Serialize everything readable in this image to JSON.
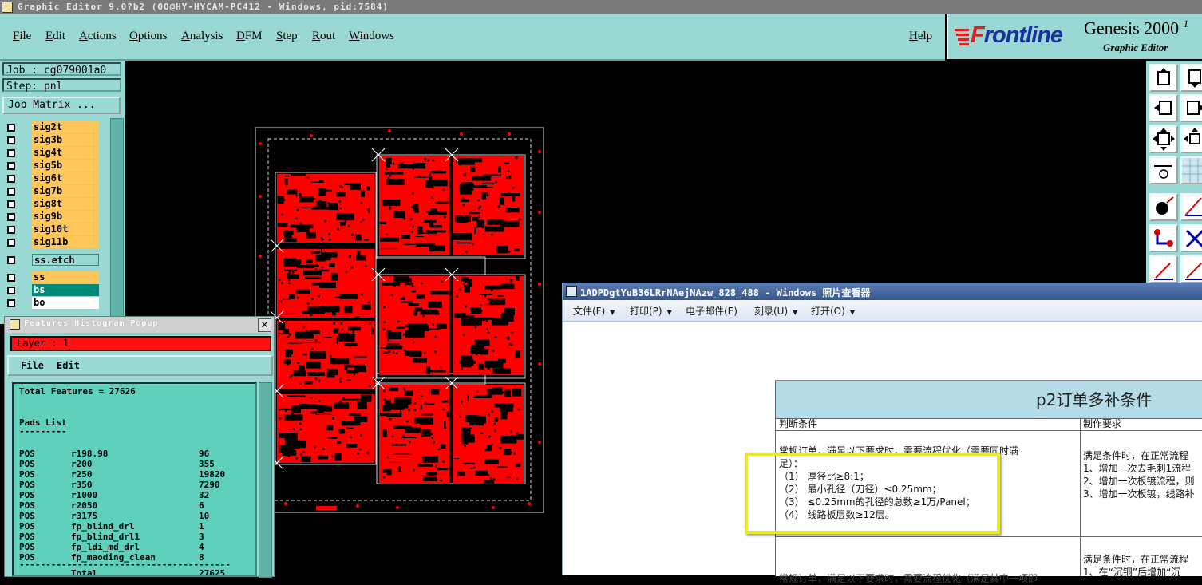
{
  "titlebar": {
    "text": "Graphic Editor 9.0?b2 (OO@HY-HYCAM-PC412 - Windows, pid:7584)"
  },
  "menubar": {
    "items": [
      "File",
      "Edit",
      "Actions",
      "Options",
      "Analysis",
      "DFM",
      "Step",
      "Rout",
      "Windows"
    ],
    "help": "Help"
  },
  "logo": {
    "brand": "Frontline",
    "product": "Genesis 2000",
    "product_suffix": "1",
    "subtitle": "Graphic Editor"
  },
  "left_panel": {
    "job": "Job : cg079001a0",
    "step": "Step: pnl",
    "job_matrix": "Job Matrix ...",
    "layers_top": [
      "sig2t",
      "sig3b",
      "sig4t",
      "sig5b",
      "sig6t",
      "sig7b",
      "sig8t",
      "sig9b",
      "sig10t",
      "sig11b"
    ],
    "layer_etch": "ss.etch",
    "layers_bottom": [
      "ss",
      "bs",
      "bo"
    ]
  },
  "colors": {
    "teal_bg": "#9ad9d3",
    "layer_orange": "#ffc65a",
    "layer_green": "#008878",
    "pcb_red": "#ff0000",
    "highlight": "#eaea2a"
  },
  "popup": {
    "title": "Features Histogram Popup",
    "layer": "Layer :  1",
    "menu": [
      "File",
      "Edit"
    ],
    "total": "Total Features = 27626",
    "pads_heading": "Pads List",
    "pads_rule": "---------",
    "rows": [
      {
        "type": "POS",
        "sym": "r198.98",
        "count": "96"
      },
      {
        "type": "POS",
        "sym": "r200",
        "count": "355"
      },
      {
        "type": "POS",
        "sym": "r250",
        "count": "19820"
      },
      {
        "type": "POS",
        "sym": "r350",
        "count": "7290"
      },
      {
        "type": "POS",
        "sym": "r1000",
        "count": "32"
      },
      {
        "type": "POS",
        "sym": "r2050",
        "count": "6"
      },
      {
        "type": "POS",
        "sym": "r3175",
        "count": "10"
      },
      {
        "type": "POS",
        "sym": "fp_blind_drl",
        "count": "1"
      },
      {
        "type": "POS",
        "sym": "fp_blind_drl1",
        "count": "3"
      },
      {
        "type": "POS",
        "sym": "fp_ldi_md_drl",
        "count": "4"
      },
      {
        "type": "POS",
        "sym": "fp_maoding_clean",
        "count": "8"
      }
    ],
    "bottom_rule": "----------------------------------------",
    "total_row": {
      "label": "Total",
      "count": "27625"
    }
  },
  "viewer": {
    "title": "1ADPDgtYuB36LRrNAejNAzw_828_488 - Windows 照片查看器",
    "menu": [
      {
        "label": "文件(F)",
        "caret": true
      },
      {
        "label": "打印(P)",
        "caret": true
      },
      {
        "label": "电子邮件(E)",
        "caret": false
      },
      {
        "label": "刻录(U)",
        "caret": true
      },
      {
        "label": "打开(O)",
        "caret": true
      }
    ],
    "doc": {
      "title": "p2订单多补条件",
      "col1_header": "判断条件",
      "col2_header": "制作要求",
      "cond_line1": "常规订单，满足以下要求时，需要流程优化（需要同时满",
      "cond_line2": "足）：",
      "conditions": [
        "（1） 厚径比≥8:1；",
        "（2） 最小孔径（刀径）≤0.25mm；",
        "（3） ≤0.25mm的孔径的总数≥1万/Panel；",
        "（4） 线路板层数≥12层。"
      ],
      "req_lines": [
        "满足条件时，在正常流程",
        "1、增加一次去毛刺1流程",
        "2、增加一次板镀流程，则",
        "3、增加一次板镀，线路补"
      ],
      "req2_lines": [
        "满足条件时，在正常流程",
        "1、在“沉铜”后增加“沉"
      ],
      "cond2_partial": "常规订单，满足以下要求时，需要流程优化（满足其中一项即"
    }
  }
}
